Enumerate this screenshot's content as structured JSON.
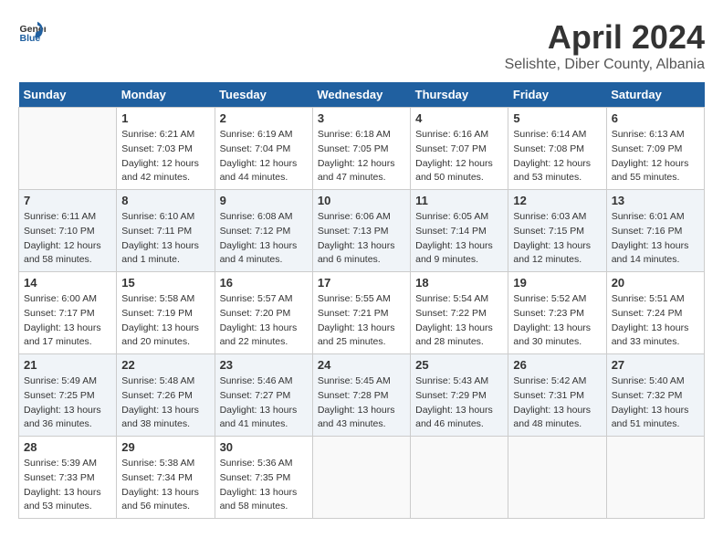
{
  "header": {
    "logo_general": "General",
    "logo_blue": "Blue",
    "month_year": "April 2024",
    "location": "Selishte, Diber County, Albania"
  },
  "weekdays": [
    "Sunday",
    "Monday",
    "Tuesday",
    "Wednesday",
    "Thursday",
    "Friday",
    "Saturday"
  ],
  "weeks": [
    [
      {
        "day": "",
        "sunrise": "",
        "sunset": "",
        "daylight": ""
      },
      {
        "day": "1",
        "sunrise": "Sunrise: 6:21 AM",
        "sunset": "Sunset: 7:03 PM",
        "daylight": "Daylight: 12 hours and 42 minutes."
      },
      {
        "day": "2",
        "sunrise": "Sunrise: 6:19 AM",
        "sunset": "Sunset: 7:04 PM",
        "daylight": "Daylight: 12 hours and 44 minutes."
      },
      {
        "day": "3",
        "sunrise": "Sunrise: 6:18 AM",
        "sunset": "Sunset: 7:05 PM",
        "daylight": "Daylight: 12 hours and 47 minutes."
      },
      {
        "day": "4",
        "sunrise": "Sunrise: 6:16 AM",
        "sunset": "Sunset: 7:07 PM",
        "daylight": "Daylight: 12 hours and 50 minutes."
      },
      {
        "day": "5",
        "sunrise": "Sunrise: 6:14 AM",
        "sunset": "Sunset: 7:08 PM",
        "daylight": "Daylight: 12 hours and 53 minutes."
      },
      {
        "day": "6",
        "sunrise": "Sunrise: 6:13 AM",
        "sunset": "Sunset: 7:09 PM",
        "daylight": "Daylight: 12 hours and 55 minutes."
      }
    ],
    [
      {
        "day": "7",
        "sunrise": "Sunrise: 6:11 AM",
        "sunset": "Sunset: 7:10 PM",
        "daylight": "Daylight: 12 hours and 58 minutes."
      },
      {
        "day": "8",
        "sunrise": "Sunrise: 6:10 AM",
        "sunset": "Sunset: 7:11 PM",
        "daylight": "Daylight: 13 hours and 1 minute."
      },
      {
        "day": "9",
        "sunrise": "Sunrise: 6:08 AM",
        "sunset": "Sunset: 7:12 PM",
        "daylight": "Daylight: 13 hours and 4 minutes."
      },
      {
        "day": "10",
        "sunrise": "Sunrise: 6:06 AM",
        "sunset": "Sunset: 7:13 PM",
        "daylight": "Daylight: 13 hours and 6 minutes."
      },
      {
        "day": "11",
        "sunrise": "Sunrise: 6:05 AM",
        "sunset": "Sunset: 7:14 PM",
        "daylight": "Daylight: 13 hours and 9 minutes."
      },
      {
        "day": "12",
        "sunrise": "Sunrise: 6:03 AM",
        "sunset": "Sunset: 7:15 PM",
        "daylight": "Daylight: 13 hours and 12 minutes."
      },
      {
        "day": "13",
        "sunrise": "Sunrise: 6:01 AM",
        "sunset": "Sunset: 7:16 PM",
        "daylight": "Daylight: 13 hours and 14 minutes."
      }
    ],
    [
      {
        "day": "14",
        "sunrise": "Sunrise: 6:00 AM",
        "sunset": "Sunset: 7:17 PM",
        "daylight": "Daylight: 13 hours and 17 minutes."
      },
      {
        "day": "15",
        "sunrise": "Sunrise: 5:58 AM",
        "sunset": "Sunset: 7:19 PM",
        "daylight": "Daylight: 13 hours and 20 minutes."
      },
      {
        "day": "16",
        "sunrise": "Sunrise: 5:57 AM",
        "sunset": "Sunset: 7:20 PM",
        "daylight": "Daylight: 13 hours and 22 minutes."
      },
      {
        "day": "17",
        "sunrise": "Sunrise: 5:55 AM",
        "sunset": "Sunset: 7:21 PM",
        "daylight": "Daylight: 13 hours and 25 minutes."
      },
      {
        "day": "18",
        "sunrise": "Sunrise: 5:54 AM",
        "sunset": "Sunset: 7:22 PM",
        "daylight": "Daylight: 13 hours and 28 minutes."
      },
      {
        "day": "19",
        "sunrise": "Sunrise: 5:52 AM",
        "sunset": "Sunset: 7:23 PM",
        "daylight": "Daylight: 13 hours and 30 minutes."
      },
      {
        "day": "20",
        "sunrise": "Sunrise: 5:51 AM",
        "sunset": "Sunset: 7:24 PM",
        "daylight": "Daylight: 13 hours and 33 minutes."
      }
    ],
    [
      {
        "day": "21",
        "sunrise": "Sunrise: 5:49 AM",
        "sunset": "Sunset: 7:25 PM",
        "daylight": "Daylight: 13 hours and 36 minutes."
      },
      {
        "day": "22",
        "sunrise": "Sunrise: 5:48 AM",
        "sunset": "Sunset: 7:26 PM",
        "daylight": "Daylight: 13 hours and 38 minutes."
      },
      {
        "day": "23",
        "sunrise": "Sunrise: 5:46 AM",
        "sunset": "Sunset: 7:27 PM",
        "daylight": "Daylight: 13 hours and 41 minutes."
      },
      {
        "day": "24",
        "sunrise": "Sunrise: 5:45 AM",
        "sunset": "Sunset: 7:28 PM",
        "daylight": "Daylight: 13 hours and 43 minutes."
      },
      {
        "day": "25",
        "sunrise": "Sunrise: 5:43 AM",
        "sunset": "Sunset: 7:29 PM",
        "daylight": "Daylight: 13 hours and 46 minutes."
      },
      {
        "day": "26",
        "sunrise": "Sunrise: 5:42 AM",
        "sunset": "Sunset: 7:31 PM",
        "daylight": "Daylight: 13 hours and 48 minutes."
      },
      {
        "day": "27",
        "sunrise": "Sunrise: 5:40 AM",
        "sunset": "Sunset: 7:32 PM",
        "daylight": "Daylight: 13 hours and 51 minutes."
      }
    ],
    [
      {
        "day": "28",
        "sunrise": "Sunrise: 5:39 AM",
        "sunset": "Sunset: 7:33 PM",
        "daylight": "Daylight: 13 hours and 53 minutes."
      },
      {
        "day": "29",
        "sunrise": "Sunrise: 5:38 AM",
        "sunset": "Sunset: 7:34 PM",
        "daylight": "Daylight: 13 hours and 56 minutes."
      },
      {
        "day": "30",
        "sunrise": "Sunrise: 5:36 AM",
        "sunset": "Sunset: 7:35 PM",
        "daylight": "Daylight: 13 hours and 58 minutes."
      },
      {
        "day": "",
        "sunrise": "",
        "sunset": "",
        "daylight": ""
      },
      {
        "day": "",
        "sunrise": "",
        "sunset": "",
        "daylight": ""
      },
      {
        "day": "",
        "sunrise": "",
        "sunset": "",
        "daylight": ""
      },
      {
        "day": "",
        "sunrise": "",
        "sunset": "",
        "daylight": ""
      }
    ]
  ]
}
